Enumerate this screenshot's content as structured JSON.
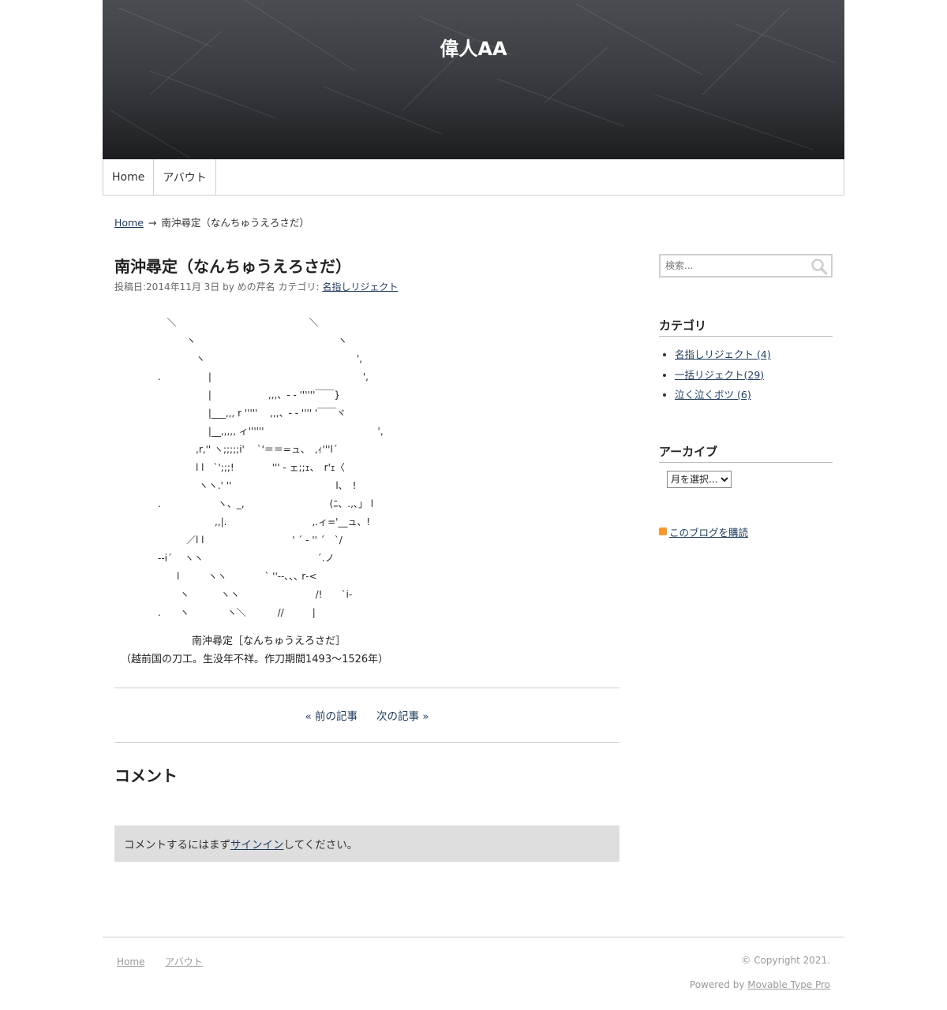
{
  "site": {
    "title": "偉人AA"
  },
  "nav": {
    "items": [
      "Home",
      "アバウト"
    ]
  },
  "breadcrumb": {
    "home": "Home",
    "arrow": "→",
    "current": "南沖尋定（なんちゅうえろさだ）"
  },
  "entry": {
    "title": "南沖尋定（なんちゅうえろさだ）",
    "meta_prefix": "投稿日:2014年11月 3日 by めの芹名 カテゴリ: ",
    "category": "名指しリジェクト",
    "aa_lines": [
      "   ＼　　　　　　　　　　　　　　＼",
      "　　　ヽ　　　　　　　　　　　　　　　ヽ",
      "　　　　ヽ　　　　　　　　　　　　　　　　',",
      ".　　　　　|　　　　　　　　　　　　　　　　',",
      "　　　　　 |　　　　　　,,,、- - ''''''￣￣}",
      "　　　　　 |___,,, r '''''　 ,,,、- - '''' '￣￣ヾ",
      "　　　　　 |__,,,,, ィ''''''　　　　　　　　　　　　',",
      "　　　　,r,'' ヽ;;;;;i'　 `'＝＝=ュ、　,ｨ'''l´",
      "　　　　l l　`';;;!　　　　''' - ェ;;ｪ、　r'ｪ〈",
      "　　　　 ヽヽ.' ''　　　　　　　　　　　l、　!",
      ".　　　　　　ヽ、_,　　　　　　　　　(ﾆ、.,､」 l",
      "　　　　　　,,|.　　　　　　　　　,.ィ='__ュ、!",
      "　　　／l l　　　　　　　　　 ' ´ - '' ´　`/",
      "--i´　 ヽヽ　　　　　　　　　　　　´.ノ",
      "　　l　　　ヽヽ　　　　` ''--､､､ r‐<",
      "　　 ヽ　　　 ヽヽ　　　　　　　　/!　　`i-",
      ".　　ヽ　　　　ヽ＼　　　 //　　　|"
    ],
    "caption_line1": "南沖尋定［なんちゅうえろさだ］",
    "caption_line2": "（越前国の刀工。生没年不祥。作刀期間1493〜1526年）"
  },
  "pager": {
    "prev": "« 前の記事",
    "next": "次の記事 »"
  },
  "comments": {
    "title": "コメント",
    "signin_prefix": "コメントするにはまず",
    "signin_link": "サインイン",
    "signin_suffix": "してください。"
  },
  "sidebar": {
    "search_placeholder": "検索...",
    "categories_title": "カテゴリ",
    "categories": [
      {
        "name": "名指しリジェクト",
        "count": "(4)"
      },
      {
        "name": "一括リジェクト",
        "count": "(29)"
      },
      {
        "name": "泣く泣くボツ",
        "count": "(6)"
      }
    ],
    "archive_title": "アーカイブ",
    "archive_select": "月を選択...",
    "subscribe": "このブログを購読"
  },
  "footer": {
    "links": [
      "Home",
      "アバウト"
    ],
    "copyright": "© Copyright 2021.",
    "powered_prefix": "Powered by ",
    "powered_link": "Movable Type Pro"
  }
}
